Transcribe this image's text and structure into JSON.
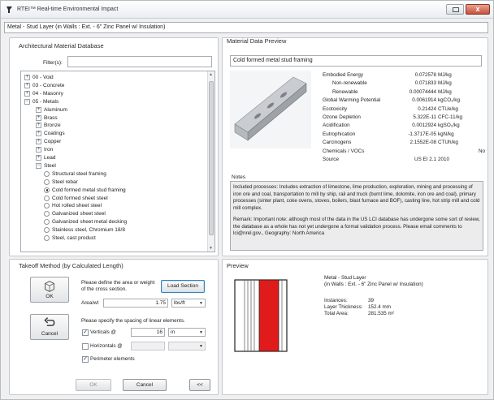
{
  "window": {
    "title": "RTEI™  Real-time Environmental Impact",
    "close_glyph": "x",
    "subtitle": "Metal - Stud Layer (in Walls : Ext. - 6\" Zinc Panel w/ Insulation)"
  },
  "database": {
    "title": "Architectural Material Database",
    "filter_label": "Filter(s):",
    "filter_value": "",
    "tree": [
      {
        "label": "00 - Void",
        "kind": "folder",
        "depth": 0
      },
      {
        "label": "03 - Concrete",
        "kind": "folder",
        "depth": 0
      },
      {
        "label": "04 - Masonry",
        "kind": "folder",
        "depth": 0
      },
      {
        "label": "05 - Metals",
        "kind": "folder",
        "depth": 0,
        "expanded": true
      },
      {
        "label": "Aluminum",
        "kind": "folder",
        "depth": 1
      },
      {
        "label": "Brass",
        "kind": "folder",
        "depth": 1
      },
      {
        "label": "Bronze",
        "kind": "folder",
        "depth": 1
      },
      {
        "label": "Coatings",
        "kind": "folder",
        "depth": 1
      },
      {
        "label": "Copper",
        "kind": "folder",
        "depth": 1
      },
      {
        "label": "Iron",
        "kind": "folder",
        "depth": 1
      },
      {
        "label": "Lead",
        "kind": "folder",
        "depth": 1
      },
      {
        "label": "Steel",
        "kind": "folder",
        "depth": 1,
        "expanded": true
      },
      {
        "label": "Structural steel framing",
        "kind": "radio",
        "depth": 2
      },
      {
        "label": "Steel rebar",
        "kind": "radio",
        "depth": 2
      },
      {
        "label": "Cold formed metal stud framing",
        "kind": "radio",
        "depth": 2,
        "selected": true
      },
      {
        "label": "Cold formed sheet steel",
        "kind": "radio",
        "depth": 2
      },
      {
        "label": "Hot rolled sheet steel",
        "kind": "radio",
        "depth": 2
      },
      {
        "label": "Galvanized sheet steel",
        "kind": "radio",
        "depth": 2
      },
      {
        "label": "Galvanized sheet metal decking",
        "kind": "radio",
        "depth": 2
      },
      {
        "label": "Stainless steel, Chromium 18/8",
        "kind": "radio",
        "depth": 2
      },
      {
        "label": "Steel, cast product",
        "kind": "radio",
        "depth": 2
      }
    ]
  },
  "material": {
    "title": "Material Data Preview",
    "name": "Cold formed metal stud framing",
    "properties": [
      {
        "label": "Embodied Energy",
        "value": "0.072578",
        "unit": "MJ/kg",
        "indent": false
      },
      {
        "label": "Non-renewable",
        "value": "0.071833",
        "unit": "MJ/kg",
        "indent": true
      },
      {
        "label": "Renewable",
        "value": "0.00074444",
        "unit": "MJ/kg",
        "indent": true
      },
      {
        "label": "Global Warming Potential",
        "value": "0.0061914",
        "unit": "kgCO₂/kg",
        "indent": false
      },
      {
        "label": "Ecotoxicity",
        "value": "0.21424",
        "unit": "CTUe/kg",
        "indent": false
      },
      {
        "label": "Ozone Depletion",
        "value": "5.322E-11",
        "unit": "CFC-11/kg",
        "indent": false
      },
      {
        "label": "Acidification",
        "value": "0.0012924",
        "unit": "kgSO₂/kg",
        "indent": false
      },
      {
        "label": "Eutrophication",
        "value": "-1.3717E-05",
        "unit": "kgN/kg",
        "indent": false
      },
      {
        "label": "Carcinogens",
        "value": "2.1552E-08",
        "unit": "CTUh/kg",
        "indent": false
      },
      {
        "label": "Chemicals / VOCs",
        "value": "",
        "unit": "No",
        "indent": false
      },
      {
        "label": "Source",
        "value": "US EI 2.1",
        "unit": "2010",
        "indent": false
      }
    ],
    "notes_label": "Notes",
    "notes_p1": "Included processes: Includes extraction of limestone, lime production, exploration, mining and processing of iron ore and coal, transportation to mill by ship, rail and truck (burnt lime, dolomite, iron ore and coal), primary processes (sinter plant, coke ovens, stoves, boilers, blast furnace and BOF), casting line, hot strip mill and cold mill complex.",
    "notes_p2": "Remark:  Important note: although most of the data in the US LCI database has  undergone some sort of review, the database as a whole has not yet  undergone a formal validation process. Please email comments to lci@nrel.gov., Geography: North America"
  },
  "takeoff": {
    "title": "Takeoff Method (by Calculated Length)",
    "ok_tile_label": "OK",
    "cancel_tile_label": "Cancel",
    "define_text": "Please define the area or weight of the cross section.",
    "load_section_label": "Load Section",
    "area_label": "Area/wt",
    "area_value": "1.75",
    "area_unit": "lbs/ft",
    "spacing_text": "Please specify the spacing of linear elements.",
    "verticals_label": "Verticals @",
    "verticals_checked": true,
    "verticals_value": "16",
    "verticals_unit": "in",
    "horizontals_label": "Horizontals @",
    "horizontals_checked": false,
    "horizontals_value": "",
    "horizontals_unit": "",
    "perimeter_label": "Perimeter elements",
    "perimeter_checked": true
  },
  "footer": {
    "ok_label": "OK",
    "cancel_label": "Cancel",
    "back_label": "<<"
  },
  "preview": {
    "title": "Preview",
    "line1": "Metal - Stud Layer",
    "line2": "(in Walls : Ext. - 6\" Zinc Panel w/ Insulation)",
    "instances_label": "Instances:",
    "instances_value": "39",
    "thickness_label": "Layer Thickness:",
    "thickness_value": "152.4 mm",
    "area_label": "Total Area:",
    "area_value": "281.535 m²"
  },
  "colors": {
    "accent_blue": "#3c7fb1",
    "stud_red": "#e01b1b",
    "panel_border": "#c4c8ce"
  },
  "icons": [
    "rtei-app-icon",
    "maximize-icon",
    "close-icon",
    "cube-outline-icon",
    "undo-arrow-icon",
    "checkbox-check-icon",
    "chevron-down-icon"
  ]
}
